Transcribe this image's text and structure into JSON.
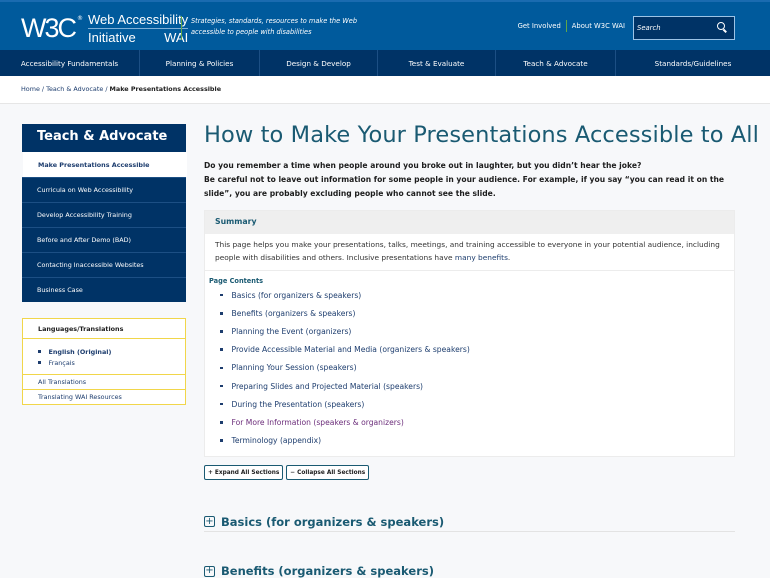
{
  "header": {
    "logo": {
      "w3c": "W3C",
      "registered": "®",
      "line1": "Web Accessibility",
      "line2a": "Initiative",
      "line2b": "WAI"
    },
    "tagline_line1": "Strategies, standards, resources to make the Web",
    "tagline_line2": "accessible to people with disabilities",
    "links": [
      "Get Involved",
      "About W3C WAI"
    ],
    "search": {
      "placeholder": "Search",
      "value": ""
    }
  },
  "nav": {
    "items": [
      "Accessibility Fundamentals",
      "Planning & Policies",
      "Design & Develop",
      "Test & Evaluate",
      "Teach & Advocate",
      "Standards/Guidelines"
    ]
  },
  "breadcrumb": {
    "items": [
      "Home",
      "Teach & Advocate"
    ],
    "separator": "/",
    "current": "Make Presentations Accessible"
  },
  "sidebar": {
    "title": "Teach & Advocate",
    "items": [
      {
        "label": "Make Presentations Accessible",
        "active": true
      },
      {
        "label": "Curricula on Web Accessibility"
      },
      {
        "label": "Develop Accessibility Training"
      },
      {
        "label": "Before and After Demo (BAD)"
      },
      {
        "label": "Contacting Inaccessible Websites"
      },
      {
        "label": "Business Case"
      }
    ],
    "languages": {
      "title": "Languages/Translations",
      "current": "English (Original)",
      "other": "Français",
      "links": [
        "All Translations",
        "Translating WAI Resources"
      ]
    }
  },
  "main": {
    "title": "How to Make Your Presentations Accessible to All",
    "intro_line1": "Do you remember a time when people around you broke out in laughter, but you didn’t hear the joke?",
    "intro_line2": "Be careful not to leave out information for some people in your audience. For example, if you say “you can read it on the slide”, you are probably excluding people who cannot see the slide.",
    "summary": {
      "heading": "Summary",
      "text": "This page helps you make your presentations, talks, meetings, and training accessible to everyone in your potential audience, including people with disabilities and others. Inclusive presentations have ",
      "link": "many benefits",
      "end": "."
    },
    "page_contents": {
      "heading": "Page Contents",
      "items": [
        "Basics (for organizers & speakers)",
        "Benefits (organizers & speakers)",
        "Planning the Event (organizers)",
        "Provide Accessible Material and Media (organizers & speakers)",
        "Planning Your Session (speakers)",
        "Preparing Slides and Projected Material (speakers)",
        "During the Presentation (speakers)",
        "For More Information (speakers & organizers)",
        "Terminology (appendix)"
      ]
    },
    "buttons": {
      "expand": "+ Expand All Sections",
      "collapse": "− Collapse All Sections"
    },
    "sections": [
      {
        "title": "Basics (for organizers & speakers)",
        "icon": "+"
      },
      {
        "title": "Benefits (organizers & speakers)",
        "icon": "+"
      }
    ]
  }
}
